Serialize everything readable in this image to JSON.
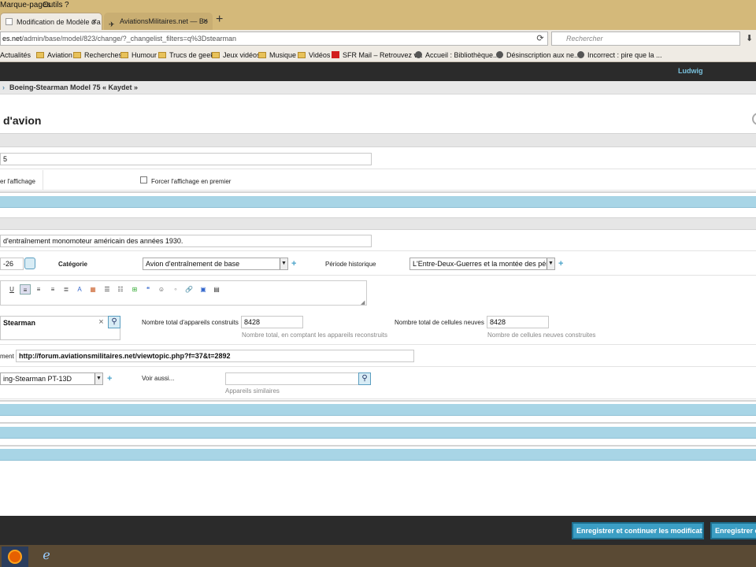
{
  "menubar": {
    "bookmarks": "Marque-pages",
    "tools": "Outils",
    "help": "?"
  },
  "tabs": [
    {
      "label": "Modification de Modèle d'a",
      "active": true
    },
    {
      "label": "AviationsMilitaires.net — Bo",
      "active": false
    }
  ],
  "newtab_label": "+",
  "url": {
    "prefix": "es.net",
    "rest": "/admin/base/model/823/change/?_changelist_filters=q%3Dstearman"
  },
  "search_placeholder": "Rechercher",
  "bookmarks": [
    {
      "label": "Actualités",
      "kind": "none"
    },
    {
      "label": "Aviation",
      "kind": "folder"
    },
    {
      "label": "Recherches",
      "kind": "folder"
    },
    {
      "label": "Humour",
      "kind": "folder"
    },
    {
      "label": "Trucs de geek",
      "kind": "folder"
    },
    {
      "label": "Jeux vidéos",
      "kind": "folder"
    },
    {
      "label": "Musique",
      "kind": "folder"
    },
    {
      "label": "Vidéos",
      "kind": "folder"
    },
    {
      "label": "SFR Mail – Retrouvez v...",
      "kind": "sfr"
    },
    {
      "label": "Accueil : Bibliothèque...",
      "kind": "globe"
    },
    {
      "label": "Désinscription aux ne...",
      "kind": "globe"
    },
    {
      "label": "Incorrect : pire que la ...",
      "kind": "globe"
    }
  ],
  "header": {
    "user": "Ludwig"
  },
  "breadcrumb": {
    "current": "Boeing-Stearman Model 75 « Kaydet »"
  },
  "page_title": "d'avion",
  "form": {
    "field_top_value": "5",
    "force_display_label": "er l'affichage",
    "force_first_label": "Forcer l'affichage en premier",
    "description_value": "d'entraînement monomoteur américain des années 1930.",
    "date_value": "-26",
    "category_label": "Catégorie",
    "category_value": "Avion d'entraînement de base",
    "period_label": "Période historique",
    "period_value": "L'Entre-Deux-Guerres et la montée des péril",
    "manufacturer_value": "Stearman",
    "built_label": "Nombre total d'appareils construits",
    "built_value": "8428",
    "built_hint": "Nombre total, en comptant les appareils reconstruits",
    "cells_label": "Nombre total de cellules neuves",
    "cells_value": "8428",
    "cells_hint": "Nombre de cellules neuves construites",
    "forum_label": "ment :",
    "forum_value": "http://forum.aviationsmilitaires.net/viewtopic.php?f=37&t=2892",
    "variant_value": "ing-Stearman PT-13D",
    "see_also_label": "Voir aussi...",
    "see_also_hint": "Appareils similaires"
  },
  "footer": {
    "save_continue": "Enregistrer et continuer les modifications",
    "save_other": "Enregistrer et"
  },
  "colors": {
    "accent_blue": "#a8d5e6",
    "header_dark": "#2b2b2b",
    "button_blue": "#3b9ec4",
    "link_user": "#79c1dd"
  }
}
